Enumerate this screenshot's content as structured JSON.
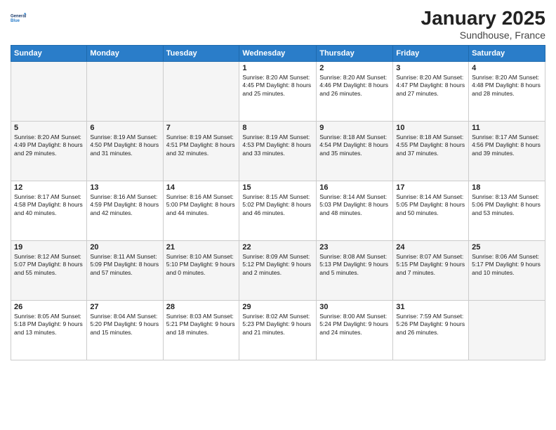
{
  "logo": {
    "line1": "General",
    "line2": "Blue"
  },
  "title": "January 2025",
  "subtitle": "Sundhouse, France",
  "weekdays": [
    "Sunday",
    "Monday",
    "Tuesday",
    "Wednesday",
    "Thursday",
    "Friday",
    "Saturday"
  ],
  "weeks": [
    [
      {
        "day": "",
        "info": ""
      },
      {
        "day": "",
        "info": ""
      },
      {
        "day": "",
        "info": ""
      },
      {
        "day": "1",
        "info": "Sunrise: 8:20 AM\nSunset: 4:45 PM\nDaylight: 8 hours\nand 25 minutes."
      },
      {
        "day": "2",
        "info": "Sunrise: 8:20 AM\nSunset: 4:46 PM\nDaylight: 8 hours\nand 26 minutes."
      },
      {
        "day": "3",
        "info": "Sunrise: 8:20 AM\nSunset: 4:47 PM\nDaylight: 8 hours\nand 27 minutes."
      },
      {
        "day": "4",
        "info": "Sunrise: 8:20 AM\nSunset: 4:48 PM\nDaylight: 8 hours\nand 28 minutes."
      }
    ],
    [
      {
        "day": "5",
        "info": "Sunrise: 8:20 AM\nSunset: 4:49 PM\nDaylight: 8 hours\nand 29 minutes."
      },
      {
        "day": "6",
        "info": "Sunrise: 8:19 AM\nSunset: 4:50 PM\nDaylight: 8 hours\nand 31 minutes."
      },
      {
        "day": "7",
        "info": "Sunrise: 8:19 AM\nSunset: 4:51 PM\nDaylight: 8 hours\nand 32 minutes."
      },
      {
        "day": "8",
        "info": "Sunrise: 8:19 AM\nSunset: 4:53 PM\nDaylight: 8 hours\nand 33 minutes."
      },
      {
        "day": "9",
        "info": "Sunrise: 8:18 AM\nSunset: 4:54 PM\nDaylight: 8 hours\nand 35 minutes."
      },
      {
        "day": "10",
        "info": "Sunrise: 8:18 AM\nSunset: 4:55 PM\nDaylight: 8 hours\nand 37 minutes."
      },
      {
        "day": "11",
        "info": "Sunrise: 8:17 AM\nSunset: 4:56 PM\nDaylight: 8 hours\nand 39 minutes."
      }
    ],
    [
      {
        "day": "12",
        "info": "Sunrise: 8:17 AM\nSunset: 4:58 PM\nDaylight: 8 hours\nand 40 minutes."
      },
      {
        "day": "13",
        "info": "Sunrise: 8:16 AM\nSunset: 4:59 PM\nDaylight: 8 hours\nand 42 minutes."
      },
      {
        "day": "14",
        "info": "Sunrise: 8:16 AM\nSunset: 5:00 PM\nDaylight: 8 hours\nand 44 minutes."
      },
      {
        "day": "15",
        "info": "Sunrise: 8:15 AM\nSunset: 5:02 PM\nDaylight: 8 hours\nand 46 minutes."
      },
      {
        "day": "16",
        "info": "Sunrise: 8:14 AM\nSunset: 5:03 PM\nDaylight: 8 hours\nand 48 minutes."
      },
      {
        "day": "17",
        "info": "Sunrise: 8:14 AM\nSunset: 5:05 PM\nDaylight: 8 hours\nand 50 minutes."
      },
      {
        "day": "18",
        "info": "Sunrise: 8:13 AM\nSunset: 5:06 PM\nDaylight: 8 hours\nand 53 minutes."
      }
    ],
    [
      {
        "day": "19",
        "info": "Sunrise: 8:12 AM\nSunset: 5:07 PM\nDaylight: 8 hours\nand 55 minutes."
      },
      {
        "day": "20",
        "info": "Sunrise: 8:11 AM\nSunset: 5:09 PM\nDaylight: 8 hours\nand 57 minutes."
      },
      {
        "day": "21",
        "info": "Sunrise: 8:10 AM\nSunset: 5:10 PM\nDaylight: 9 hours\nand 0 minutes."
      },
      {
        "day": "22",
        "info": "Sunrise: 8:09 AM\nSunset: 5:12 PM\nDaylight: 9 hours\nand 2 minutes."
      },
      {
        "day": "23",
        "info": "Sunrise: 8:08 AM\nSunset: 5:13 PM\nDaylight: 9 hours\nand 5 minutes."
      },
      {
        "day": "24",
        "info": "Sunrise: 8:07 AM\nSunset: 5:15 PM\nDaylight: 9 hours\nand 7 minutes."
      },
      {
        "day": "25",
        "info": "Sunrise: 8:06 AM\nSunset: 5:17 PM\nDaylight: 9 hours\nand 10 minutes."
      }
    ],
    [
      {
        "day": "26",
        "info": "Sunrise: 8:05 AM\nSunset: 5:18 PM\nDaylight: 9 hours\nand 13 minutes."
      },
      {
        "day": "27",
        "info": "Sunrise: 8:04 AM\nSunset: 5:20 PM\nDaylight: 9 hours\nand 15 minutes."
      },
      {
        "day": "28",
        "info": "Sunrise: 8:03 AM\nSunset: 5:21 PM\nDaylight: 9 hours\nand 18 minutes."
      },
      {
        "day": "29",
        "info": "Sunrise: 8:02 AM\nSunset: 5:23 PM\nDaylight: 9 hours\nand 21 minutes."
      },
      {
        "day": "30",
        "info": "Sunrise: 8:00 AM\nSunset: 5:24 PM\nDaylight: 9 hours\nand 24 minutes."
      },
      {
        "day": "31",
        "info": "Sunrise: 7:59 AM\nSunset: 5:26 PM\nDaylight: 9 hours\nand 26 minutes."
      },
      {
        "day": "",
        "info": ""
      }
    ]
  ]
}
